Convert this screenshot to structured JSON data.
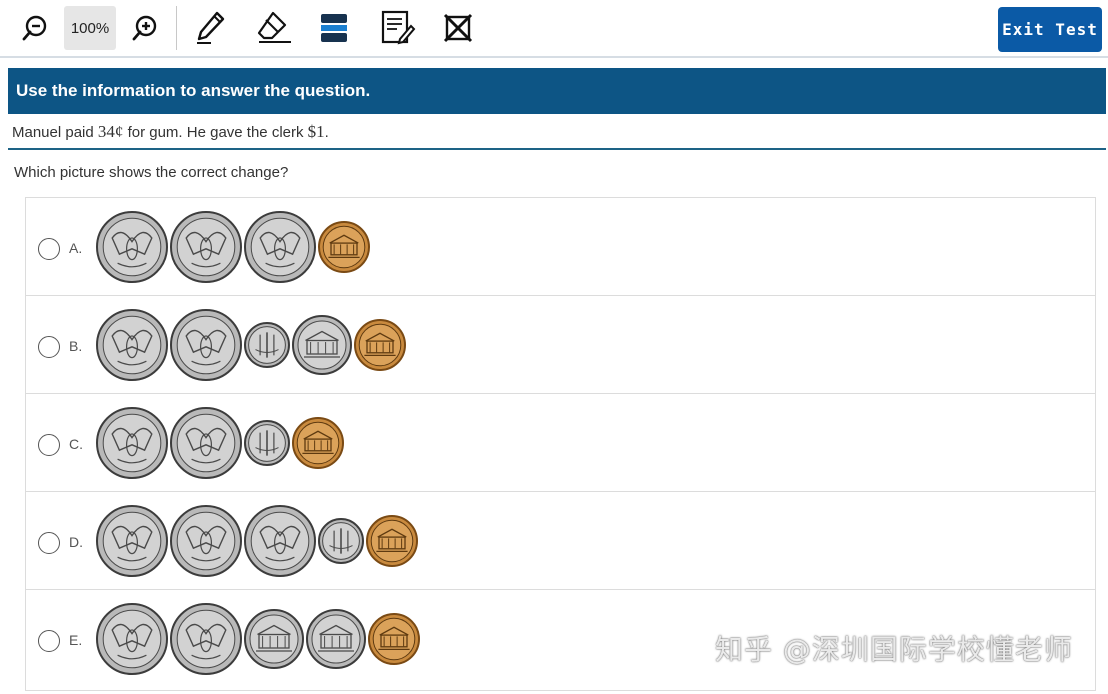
{
  "toolbar": {
    "zoom_value": "100%",
    "exit_label": "Exit Test",
    "exit_color": "#0b5aa6",
    "icons": [
      "zoom-out-icon",
      "zoom-in-icon",
      "pen-icon",
      "eraser-icon",
      "line-reader-icon",
      "notepad-icon",
      "answer-eliminator-icon"
    ]
  },
  "stimulus": {
    "header": "Use the information to answer the question.",
    "text_before": "Manuel paid ",
    "amount_paid": "34¢",
    "text_middle": " for gum. He gave the clerk ",
    "amount_given": "$1",
    "text_after": "."
  },
  "question": {
    "prompt": "Which picture shows the correct change?"
  },
  "options": [
    {
      "letter": "A.",
      "coins": [
        "quarter",
        "quarter",
        "quarter",
        "penny"
      ]
    },
    {
      "letter": "B.",
      "coins": [
        "quarter",
        "quarter",
        "dime",
        "nickel",
        "penny"
      ]
    },
    {
      "letter": "C.",
      "coins": [
        "quarter",
        "quarter",
        "dime",
        "penny"
      ]
    },
    {
      "letter": "D.",
      "coins": [
        "quarter",
        "quarter",
        "quarter",
        "dime",
        "penny"
      ]
    },
    {
      "letter": "E.",
      "coins": [
        "quarter",
        "quarter",
        "nickel",
        "nickel",
        "penny"
      ]
    }
  ],
  "watermark": "知乎 @深圳国际学校懂老师"
}
